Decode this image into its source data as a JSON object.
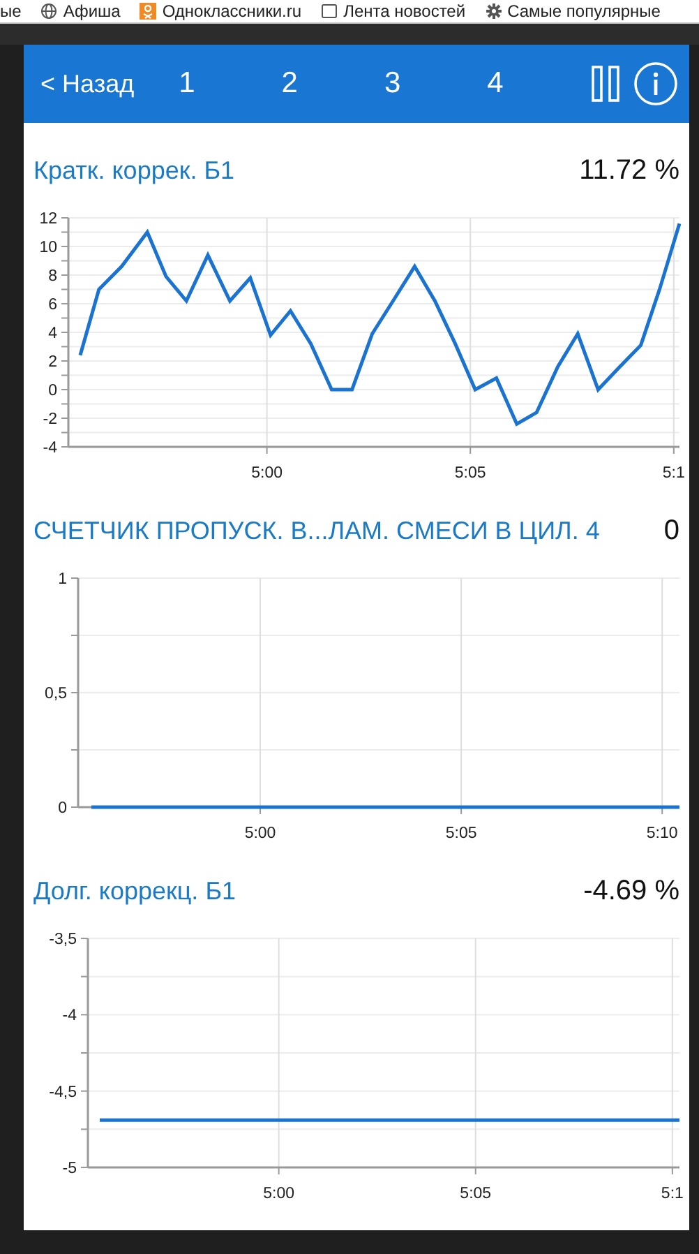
{
  "bookmarks": [
    {
      "label": "ые"
    },
    {
      "label": "Афиша"
    },
    {
      "label": "Одноклассники.ru"
    },
    {
      "label": "Лента новостей"
    },
    {
      "label": "Самые популярные"
    }
  ],
  "header": {
    "back": "< Назад",
    "tabs": [
      {
        "label": "1"
      },
      {
        "label": "2"
      },
      {
        "label": "3"
      },
      {
        "label": "4"
      }
    ]
  },
  "panels": [
    {
      "title": "Кратк. коррек. Б1",
      "value": "11.72 %",
      "chart_data": {
        "type": "line",
        "grid": true,
        "x": [
          295.41,
          295.87,
          296.43,
          297.06,
          297.52,
          298.02,
          298.55,
          299.09,
          299.59,
          300.09,
          300.58,
          301.08,
          301.59,
          302.09,
          302.59,
          303.1,
          303.63,
          304.13,
          304.63,
          305.12,
          305.64,
          306.14,
          306.63,
          307.15,
          307.64,
          308.14,
          308.64,
          309.19,
          309.65,
          310.14
        ],
        "series": [
          {
            "color": "#1a73d0",
            "values": [
              2.4,
              7.0,
              8.6,
              11,
              7.9,
              6.2,
              9.4,
              6.2,
              7.8,
              3.8,
              5.5,
              3.2,
              0,
              0,
              3.9,
              6.2,
              8.6,
              6.2,
              3.2,
              0,
              0.8,
              -2.4,
              -1.6,
              1.6,
              3.9,
              0,
              1.5,
              3.1,
              7.0,
              11.6
            ]
          }
        ],
        "xlim": [
          295.12,
          310.14
        ],
        "ylim": [
          -4,
          12
        ],
        "xticks": [
          {
            "value": 300,
            "label": "5:00"
          },
          {
            "value": 305,
            "label": "5:05"
          },
          {
            "value": 310,
            "label": "5:1"
          }
        ],
        "yticks": [
          -4,
          -2,
          0,
          2,
          4,
          6,
          8,
          10,
          12
        ]
      }
    },
    {
      "title": "СЧЕТЧИК ПРОПУСК. В...ЛАМ. СМЕСИ В ЦИЛ. 4",
      "value": "0",
      "chart_data": {
        "type": "line",
        "grid": true,
        "x": [
          295.8,
          310.43
        ],
        "series": [
          {
            "color": "#1a73d0",
            "values": [
              0,
              0
            ]
          }
        ],
        "xlim": [
          295.47,
          310.43
        ],
        "ylim": [
          0,
          1
        ],
        "xticks": [
          {
            "value": 300,
            "label": "5:00"
          },
          {
            "value": 305,
            "label": "5:05"
          },
          {
            "value": 310,
            "label": "5:10"
          }
        ],
        "yticks": [
          0,
          {
            "value": 0.5,
            "label": "0,5"
          },
          1
        ]
      }
    },
    {
      "title": "Долг. коррекц. Б1",
      "value": "-4.69 %",
      "chart_data": {
        "type": "line",
        "grid": true,
        "x": [
          295.45,
          310.18
        ],
        "series": [
          {
            "color": "#1a73d0",
            "values": [
              -4.69,
              -4.69
            ]
          }
        ],
        "xlim": [
          295.15,
          310.18
        ],
        "ylim": [
          -5,
          -3.5
        ],
        "xticks": [
          {
            "value": 300,
            "label": "5:00"
          },
          {
            "value": 305,
            "label": "5:05"
          },
          {
            "value": 310,
            "label": "5:1"
          }
        ],
        "yticks": [
          -5,
          {
            "value": -4.5,
            "label": "-4,5"
          },
          -4,
          {
            "value": -3.5,
            "label": "-3,5"
          }
        ]
      }
    }
  ]
}
